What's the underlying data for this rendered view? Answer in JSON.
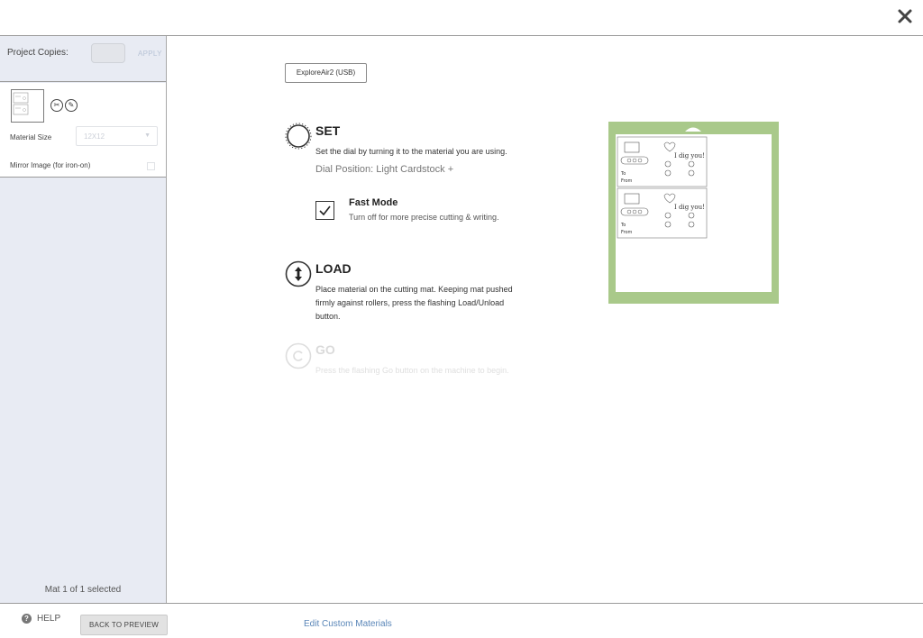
{
  "header": {
    "close_icon": "close-icon"
  },
  "sidebar": {
    "project_copies_label": "Project Copies:",
    "project_copies_value": "",
    "apply_label": "APPLY",
    "material_size_label": "Material Size",
    "material_size_value": "12X12",
    "mirror_label": "Mirror Image (for iron-on)",
    "mirror_checked": false,
    "tool_icons": [
      "scissors-icon",
      "pen-icon"
    ],
    "mat_status": "Mat 1 of 1 selected"
  },
  "main": {
    "machine_label": "ExploreAir2 (USB)",
    "set": {
      "title": "SET",
      "description": "Set the dial by turning it to the material you are using.",
      "dial_position": "Dial Position: Light Cardstock +"
    },
    "fast_mode": {
      "title": "Fast Mode",
      "description": "Turn off for more precise cutting & writing.",
      "checked": true
    },
    "load": {
      "title": "LOAD",
      "description_lines": [
        "Place material on the cutting mat. Keeping mat pushed",
        "firmly against rollers, press the flashing Load/Unload",
        "button."
      ]
    },
    "go": {
      "title": "GO",
      "description": "Press the flashing Go button on the machine to begin."
    }
  },
  "mat_preview": {
    "mat_color": "#a9c98a",
    "cards": [
      {
        "text_main": "I dig you!",
        "to_label": "To",
        "from_label": "From"
      },
      {
        "text_main": "I dig you!",
        "to_label": "To",
        "from_label": "From"
      }
    ]
  },
  "footer": {
    "help_label": "HELP",
    "back_label": "BACK TO PREVIEW",
    "edit_link": "Edit Custom Materials"
  }
}
